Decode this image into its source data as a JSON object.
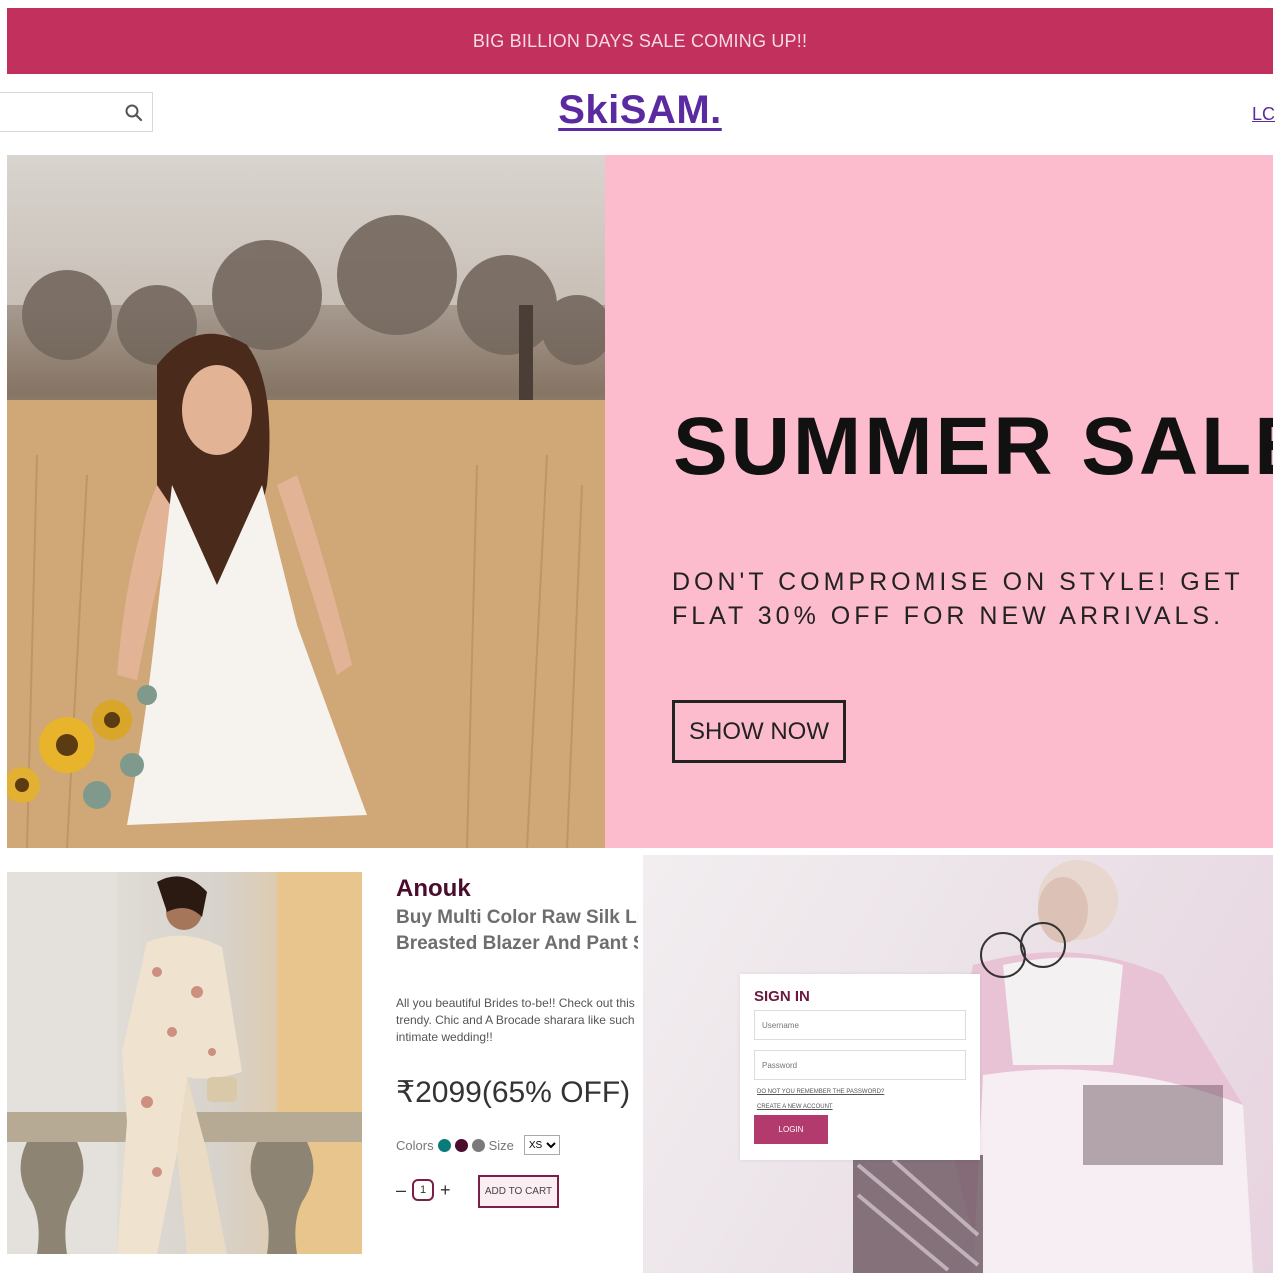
{
  "announcement": {
    "text": "BIG BILLION DAYS SALE COMING UP!!"
  },
  "header": {
    "search": {
      "value": "",
      "icon": "search-icon"
    },
    "logo": "SkiSAM.",
    "login_link": "LC"
  },
  "hero": {
    "title": "SUMMER SALE",
    "subtitle": "DON'T COMPROMISE ON STYLE! GET FLAT 30% OFF FOR NEW ARRIVALS.",
    "button_label": "SHOW NOW",
    "panel_color": "#fdbcce"
  },
  "product": {
    "brand": "Anouk",
    "name": "Buy Multi Color Raw Silk Lining: Double Breasted Blazer And Pant Set For Women",
    "description": "All you beautiful Brides to-be!! Check out this silhouette which would look trendy. Chic and A Brocade sharara like such would be an option for your intimate wedding!!",
    "price": "₹2099(65% OFF)",
    "colors_label": "Colors",
    "colors": [
      "#0b7a7a",
      "#4a0d2d",
      "#7a7a7a"
    ],
    "size_label": "Size",
    "size_value": "XS",
    "quantity": "1",
    "minus": "–",
    "plus": "+",
    "add_to_cart": "ADD TO CART"
  },
  "login": {
    "title": "SIGN IN",
    "username_placeholder": "Username",
    "password_placeholder": "Password",
    "forgot_link": "DO NOT YOU REMEMBER THE PASSWORD?",
    "create_link": "CREATE A NEW ACCOUNT",
    "button_label": "LOGIN"
  },
  "brand_colors": {
    "banner": "#c2305e",
    "logo": "#5b2aa0",
    "accent": "#b23a6d"
  }
}
